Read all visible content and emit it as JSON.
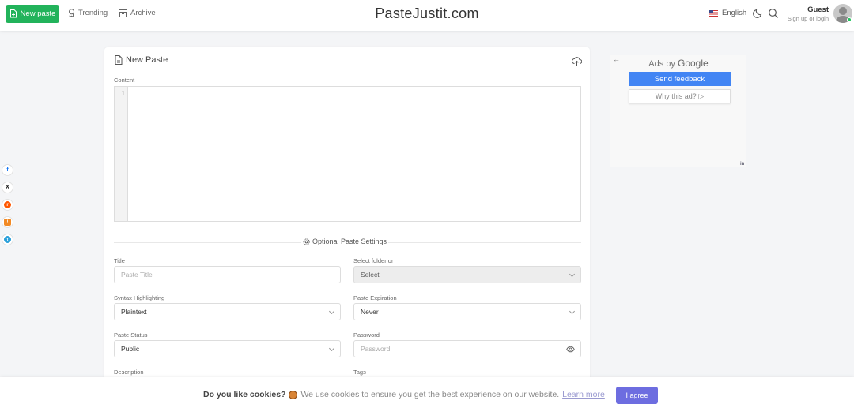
{
  "header": {
    "new_paste_label": "New paste",
    "trending_label": "Trending",
    "archive_label": "Archive",
    "brand": "PasteJustit.com",
    "language": "English",
    "user_name": "Guest",
    "user_sub": "Sign up or login"
  },
  "social": [
    "f",
    "X",
    "r",
    "!",
    "t"
  ],
  "card": {
    "title": "New Paste",
    "content_label": "Content",
    "line_number": "1",
    "optional_title": "Optional Paste Settings",
    "title_label": "Title",
    "title_placeholder": "Paste Title",
    "folder_label": "Select folder or",
    "folder_value": "Select",
    "syntax_label": "Syntax Highlighting",
    "syntax_value": "Plaintext",
    "expiration_label": "Paste Expiration",
    "expiration_value": "Never",
    "status_label": "Paste Status",
    "status_value": "Public",
    "password_label": "Password",
    "password_placeholder": "Password",
    "description_label": "Description",
    "tags_label": "Tags"
  },
  "ad": {
    "back": "←",
    "ads_by": "Ads by",
    "google": "Google",
    "send_feedback": "Send feedback",
    "why": "Why this ad? ▷",
    "corner": "in"
  },
  "cookie": {
    "question": "Do you like cookies?",
    "text": "We use cookies to ensure you get the best experience on our website.",
    "learn_more": "Learn more",
    "agree": "I agree"
  }
}
